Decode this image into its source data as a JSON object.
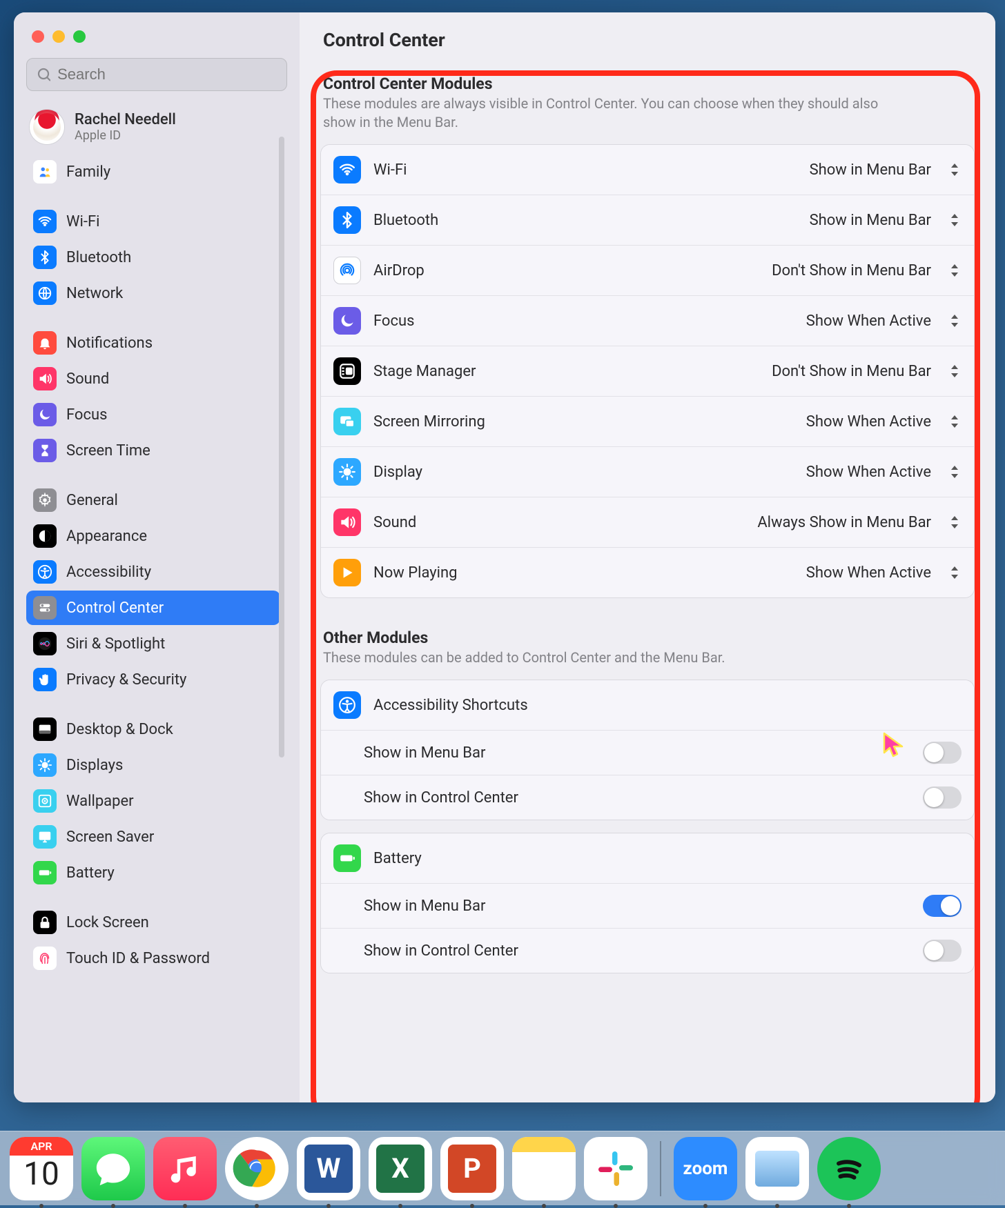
{
  "window": {
    "title": "Control Center"
  },
  "search": {
    "placeholder": "Search"
  },
  "account": {
    "name": "Rachel Needell",
    "sub": "Apple ID"
  },
  "sidebar": {
    "items": [
      {
        "label": "Family",
        "icon": "family",
        "color": "#ffffff"
      },
      {
        "gap": true
      },
      {
        "label": "Wi-Fi",
        "icon": "wifi",
        "color": "#0a7bff"
      },
      {
        "label": "Bluetooth",
        "icon": "bluetooth",
        "color": "#0a7bff"
      },
      {
        "label": "Network",
        "icon": "network",
        "color": "#0a7bff"
      },
      {
        "gap": true
      },
      {
        "label": "Notifications",
        "icon": "bell",
        "color": "#ff4b3e"
      },
      {
        "label": "Sound",
        "icon": "sound",
        "color": "#ff3568"
      },
      {
        "label": "Focus",
        "icon": "moon",
        "color": "#6b5ce7"
      },
      {
        "label": "Screen Time",
        "icon": "hourglass",
        "color": "#6b5ce7"
      },
      {
        "gap": true
      },
      {
        "label": "General",
        "icon": "gear",
        "color": "#8e8e93"
      },
      {
        "label": "Appearance",
        "icon": "appearance",
        "color": "#000"
      },
      {
        "label": "Accessibility",
        "icon": "accessibility",
        "color": "#0a7bff"
      },
      {
        "label": "Control Center",
        "icon": "control-center",
        "color": "#8e8e93",
        "selected": true
      },
      {
        "label": "Siri & Spotlight",
        "icon": "siri",
        "color": "#000"
      },
      {
        "label": "Privacy & Security",
        "icon": "hand",
        "color": "#0a7bff"
      },
      {
        "gap": true
      },
      {
        "label": "Desktop & Dock",
        "icon": "dock",
        "color": "#000"
      },
      {
        "label": "Displays",
        "icon": "display",
        "color": "#2da8ff"
      },
      {
        "label": "Wallpaper",
        "icon": "wallpaper",
        "color": "#39d0ef"
      },
      {
        "label": "Screen Saver",
        "icon": "screensaver",
        "color": "#39d0ef"
      },
      {
        "label": "Battery",
        "icon": "battery",
        "color": "#32d74b"
      },
      {
        "gap": true
      },
      {
        "label": "Lock Screen",
        "icon": "lock",
        "color": "#000"
      },
      {
        "label": "Touch ID & Password",
        "icon": "fingerprint",
        "color": "#fff"
      }
    ]
  },
  "sections": {
    "modules": {
      "title": "Control Center Modules",
      "desc": "These modules are always visible in Control Center. You can choose when they should also show in the Menu Bar.",
      "rows": [
        {
          "label": "Wi-Fi",
          "icon": "wifi",
          "color": "#0a7bff",
          "value": "Show in Menu Bar"
        },
        {
          "label": "Bluetooth",
          "icon": "bluetooth",
          "color": "#0a7bff",
          "value": "Show in Menu Bar"
        },
        {
          "label": "AirDrop",
          "icon": "airdrop",
          "color": "#fff",
          "value": "Don't Show in Menu Bar"
        },
        {
          "label": "Focus",
          "icon": "moon",
          "color": "#6b5ce7",
          "value": "Show When Active"
        },
        {
          "label": "Stage Manager",
          "icon": "stage",
          "color": "#000",
          "value": "Don't Show in Menu Bar"
        },
        {
          "label": "Screen Mirroring",
          "icon": "mirror",
          "color": "#39d0ef",
          "value": "Show When Active"
        },
        {
          "label": "Display",
          "icon": "display",
          "color": "#2da8ff",
          "value": "Show When Active"
        },
        {
          "label": "Sound",
          "icon": "sound",
          "color": "#ff3568",
          "value": "Always Show in Menu Bar"
        },
        {
          "label": "Now Playing",
          "icon": "play",
          "color": "#ff9f0a",
          "value": "Show When Active"
        }
      ]
    },
    "other": {
      "title": "Other Modules",
      "desc": "These modules can be added to Control Center and the Menu Bar.",
      "groups": [
        {
          "label": "Accessibility Shortcuts",
          "icon": "accessibility",
          "color": "#0a7bff",
          "toggles": [
            {
              "label": "Show in Menu Bar",
              "on": false
            },
            {
              "label": "Show in Control Center",
              "on": false
            }
          ]
        },
        {
          "label": "Battery",
          "icon": "battery",
          "color": "#32d74b",
          "toggles": [
            {
              "label": "Show in Menu Bar",
              "on": true
            },
            {
              "label": "Show in Control Center",
              "on": false
            }
          ]
        }
      ]
    }
  },
  "dock": {
    "date_month": "APR",
    "date_day": "10",
    "items": [
      {
        "name": "calendar"
      },
      {
        "name": "messages"
      },
      {
        "name": "music"
      },
      {
        "name": "chrome"
      },
      {
        "name": "word"
      },
      {
        "name": "excel"
      },
      {
        "name": "powerpoint"
      },
      {
        "name": "notes"
      },
      {
        "name": "slack"
      },
      {
        "sep": true
      },
      {
        "name": "zoom"
      },
      {
        "name": "preview"
      },
      {
        "name": "spotify"
      }
    ]
  }
}
